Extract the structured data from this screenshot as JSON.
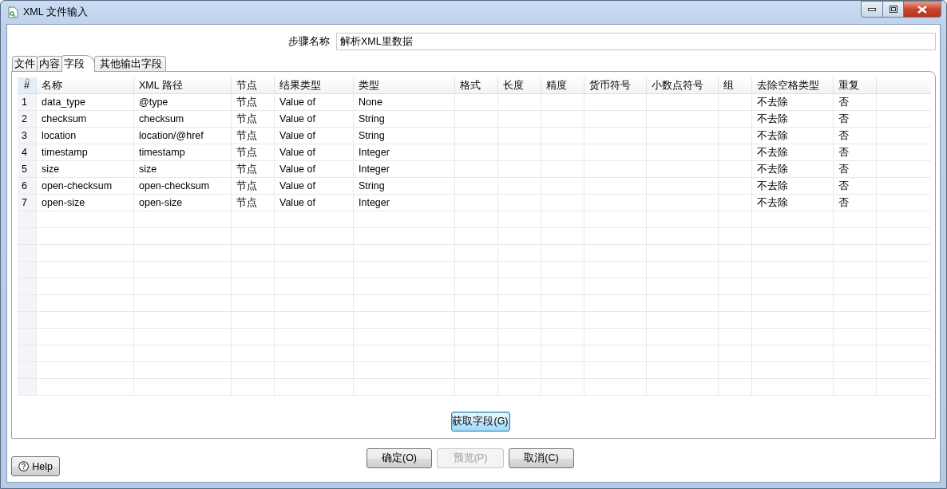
{
  "window": {
    "title": "XML 文件输入"
  },
  "step_name": {
    "label": "步骤名称",
    "value": "解析XML里数据"
  },
  "tabs": [
    {
      "label": "文件",
      "selected": false
    },
    {
      "label": "内容",
      "selected": false
    },
    {
      "label": "字段",
      "selected": true
    },
    {
      "label": "其他输出字段",
      "selected": false
    }
  ],
  "table": {
    "columns": [
      "#",
      "名称",
      "XML 路径",
      "节点",
      "结果类型",
      "类型",
      "格式",
      "长度",
      "精度",
      "货币符号",
      "小数点符号",
      "组",
      "去除空格类型",
      "重复"
    ],
    "rows": [
      [
        "1",
        "data_type",
        "@type",
        "节点",
        "Value of",
        "None",
        "",
        "",
        "",
        "",
        "",
        "",
        "不去除",
        "否"
      ],
      [
        "2",
        "checksum",
        "checksum",
        "节点",
        "Value of",
        "String",
        "",
        "",
        "",
        "",
        "",
        "",
        "不去除",
        "否"
      ],
      [
        "3",
        "location",
        "location/@href",
        "节点",
        "Value of",
        "String",
        "",
        "",
        "",
        "",
        "",
        "",
        "不去除",
        "否"
      ],
      [
        "4",
        "timestamp",
        "timestamp",
        "节点",
        "Value of",
        "Integer",
        "",
        "",
        "",
        "",
        "",
        "",
        "不去除",
        "否"
      ],
      [
        "5",
        "size",
        "size",
        "节点",
        "Value of",
        "Integer",
        "",
        "",
        "",
        "",
        "",
        "",
        "不去除",
        "否"
      ],
      [
        "6",
        "open-checksum",
        "open-checksum",
        "节点",
        "Value of",
        "String",
        "",
        "",
        "",
        "",
        "",
        "",
        "不去除",
        "否"
      ],
      [
        "7",
        "open-size",
        "open-size",
        "节点",
        "Value of",
        "Integer",
        "",
        "",
        "",
        "",
        "",
        "",
        "不去除",
        "否"
      ]
    ]
  },
  "get_fields_button": {
    "label": "获取字段(G)"
  },
  "help_button": {
    "label": "Help"
  },
  "buttons": [
    {
      "label": "确定(O)",
      "disabled": false
    },
    {
      "label": "预览(P)",
      "disabled": true
    },
    {
      "label": "取消(C)",
      "disabled": false
    }
  ]
}
